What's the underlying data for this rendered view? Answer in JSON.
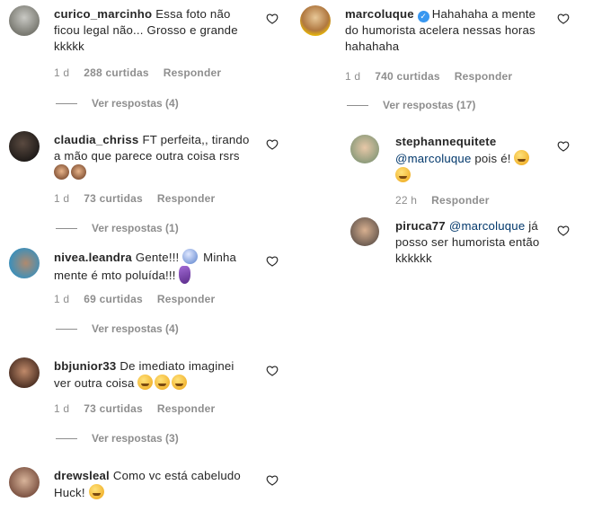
{
  "left_comments": [
    {
      "username": "curico_marcinho",
      "text": "Essa foto não ficou legal não... Grosso e grande kkkkk",
      "time": "1 d",
      "likes": "288 curtidas",
      "reply": "Responder",
      "view_replies": "Ver respostas (4)"
    },
    {
      "username": "claudia_chriss",
      "text": "FT perfeita,, tirando a mão que parece outra coisa rsrs",
      "time": "1 d",
      "likes": "73 curtidas",
      "reply": "Responder",
      "view_replies": "Ver respostas (1)"
    },
    {
      "username": "nivea.leandra",
      "text": "Gente!!! ",
      "text2": " Minha mente é mto poluída!!! ",
      "time": "1 d",
      "likes": "69 curtidas",
      "reply": "Responder",
      "view_replies": "Ver respostas (4)"
    },
    {
      "username": "bbjunior33",
      "text": "De imediato imaginei ver outra coisa",
      "time": "1 d",
      "likes": "73 curtidas",
      "reply": "Responder",
      "view_replies": "Ver respostas (3)"
    },
    {
      "username": "drewsleal",
      "text": "Como vc está cabeludo Huck! "
    }
  ],
  "right_comments": [
    {
      "username": "marcoluque",
      "text": "Hahahaha a mente do humorista acelera nessas horas hahahaha",
      "time": "1 d",
      "likes": "740 curtidas",
      "reply": "Responder",
      "view_replies": "Ver respostas (17)"
    }
  ],
  "replies": [
    {
      "username": "stephannequitete",
      "mention": "@marcoluque",
      "text": " pois é! ",
      "time": "22 h",
      "reply": "Responder"
    },
    {
      "username": "piruca77",
      "mention": "@marcoluque",
      "text": " já posso ser humorista então kkkkkk"
    }
  ],
  "colors": {
    "link": "#00376b",
    "muted": "#8e8e8e",
    "verified": "#3897f0"
  },
  "icons": [
    "heart-outline-icon",
    "verified-badge-icon"
  ]
}
